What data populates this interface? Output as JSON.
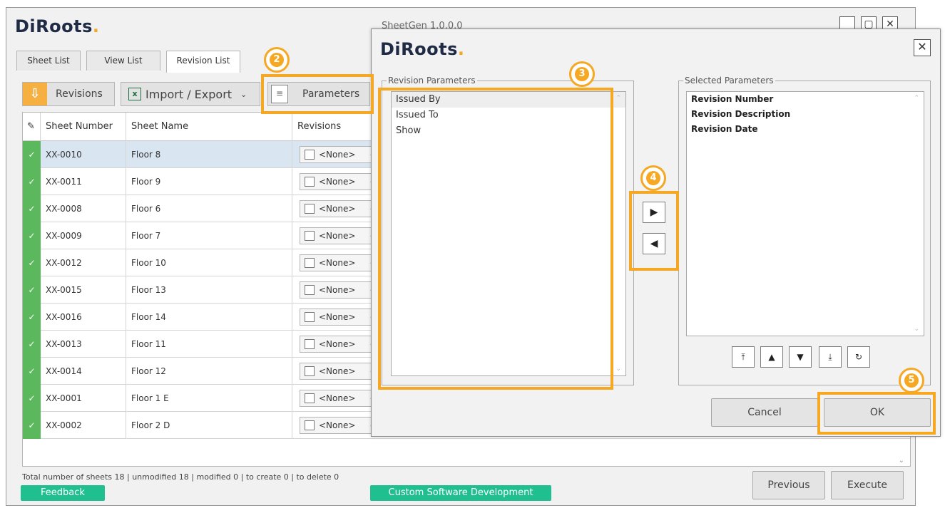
{
  "main_window": {
    "logo": "DiRoots",
    "title": "SheetGen 1.0.0.0",
    "tabs": [
      "Sheet List",
      "View List",
      "Revision List"
    ],
    "toolbar": {
      "revisions": "Revisions",
      "import_export": "Import / Export",
      "parameters": "Parameters"
    },
    "columns": [
      "Sheet Number",
      "Sheet Name",
      "Revisions"
    ],
    "rows": [
      {
        "number": "XX-0010",
        "name": "Floor 8",
        "revision": "<None>"
      },
      {
        "number": "XX-0011",
        "name": "Floor 9",
        "revision": "<None>"
      },
      {
        "number": "XX-0008",
        "name": "Floor 6",
        "revision": "<None>"
      },
      {
        "number": "XX-0009",
        "name": "Floor 7",
        "revision": "<None>"
      },
      {
        "number": "XX-0012",
        "name": "Floor 10",
        "revision": "<None>"
      },
      {
        "number": "XX-0015",
        "name": "Floor 13",
        "revision": "<None>"
      },
      {
        "number": "XX-0016",
        "name": "Floor 14",
        "revision": "<None>"
      },
      {
        "number": "XX-0013",
        "name": "Floor 11",
        "revision": "<None>"
      },
      {
        "number": "XX-0014",
        "name": "Floor 12",
        "revision": "<None>"
      },
      {
        "number": "XX-0001",
        "name": "Floor 1 E",
        "revision": "<None>"
      },
      {
        "number": "XX-0002",
        "name": "Floor 2 D",
        "revision": "<None>"
      }
    ],
    "status": "Total number of sheets 18 | unmodified 18 | modified 0 | to create 0 | to delete 0",
    "feedback": "Feedback",
    "custom_dev": "Custom Software Development",
    "previous": "Previous",
    "execute": "Execute"
  },
  "dialog": {
    "logo": "DiRoots",
    "revision_parameters_title": "Revision Parameters",
    "revision_parameters": [
      "Issued By",
      "Issued To",
      "Show"
    ],
    "selected_parameters_title": "Selected Parameters",
    "selected_parameters": [
      "Revision Number",
      "Revision Description",
      "Revision Date"
    ],
    "cancel": "Cancel",
    "ok": "OK"
  },
  "annotations": [
    "2",
    "3",
    "4",
    "5"
  ],
  "colors": {
    "highlight": "#f7a823",
    "green": "#1fbf8f",
    "row_check": "#5cb85c"
  }
}
